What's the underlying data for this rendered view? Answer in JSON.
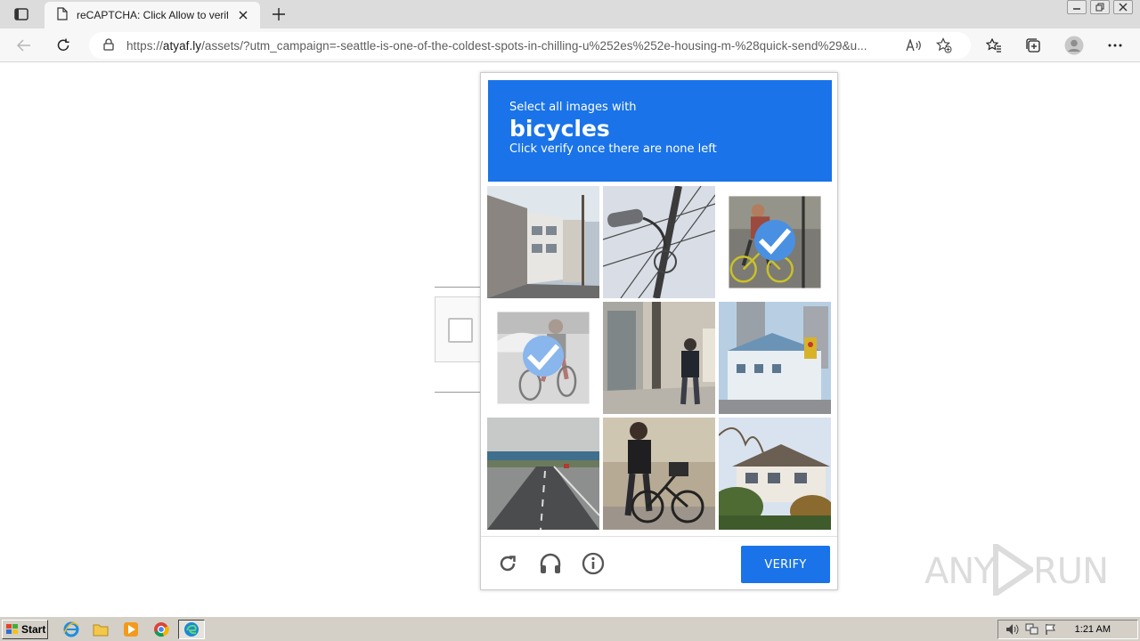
{
  "browser": {
    "tab_title": "reCAPTCHA: Click Allow to verify",
    "url_prefix": "https://",
    "url_domain": "atyaf.ly",
    "url_rest": "/assets/?utm_campaign=-seattle-is-one-of-the-coldest-spots-in-chilling-u%252es%252e-housing-m-%28quick-send%29&u...",
    "icons": [
      "tab-actions-icon",
      "page-icon",
      "close-icon",
      "plus-icon",
      "back-icon",
      "refresh-icon",
      "lock-icon",
      "read-aloud-icon",
      "add-favorite-icon",
      "favorites-icon",
      "collections-icon",
      "profile-icon",
      "more-icon"
    ]
  },
  "captcha": {
    "prompt_line1": "Select all images with",
    "prompt_target": "bicycles",
    "prompt_line3": "Click verify once there are none left",
    "tiles": [
      {
        "scene": "street with buildings",
        "selected": false
      },
      {
        "scene": "street lamp and wires",
        "selected": false
      },
      {
        "scene": "cyclist on road",
        "selected": true
      },
      {
        "scene": "cyclist by car",
        "selected": true
      },
      {
        "scene": "pedestrian by doorway",
        "selected": false
      },
      {
        "scene": "buildings with traffic light",
        "selected": false
      },
      {
        "scene": "highway with bridge",
        "selected": false
      },
      {
        "scene": "man walking bicycle",
        "selected": false
      },
      {
        "scene": "house with trees",
        "selected": false
      }
    ],
    "verify_label": "VERIFY",
    "footer_icons": [
      "reload-icon",
      "audio-icon",
      "info-icon"
    ],
    "accent_color": "#1a73e8"
  },
  "watermark": {
    "text_left": "ANY",
    "text_right": "RUN"
  },
  "taskbar": {
    "start_label": "Start",
    "clock": "1:21 AM",
    "apps": [
      "internet-explorer-icon",
      "file-explorer-icon",
      "media-player-icon",
      "chrome-icon",
      "edge-icon"
    ]
  }
}
